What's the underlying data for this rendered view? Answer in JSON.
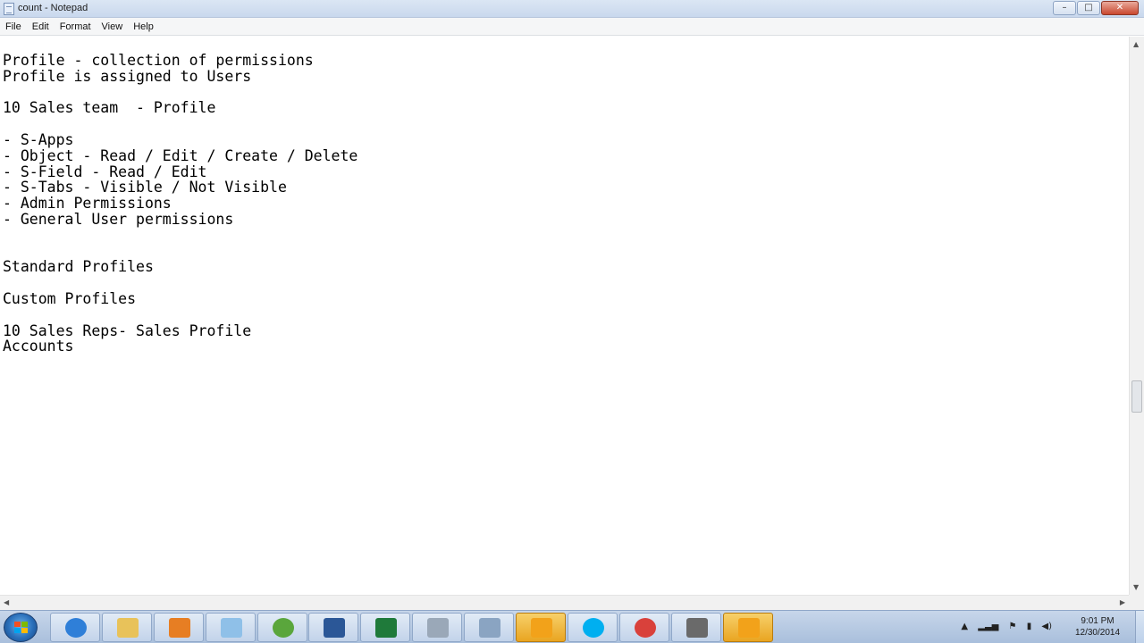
{
  "window": {
    "title": "count - Notepad",
    "minimize": "–",
    "maximize": "□",
    "close": "✕"
  },
  "menu": [
    "File",
    "Edit",
    "Format",
    "View",
    "Help"
  ],
  "editor": {
    "lines": [
      "Profile - collection of permissions",
      "Profile is assigned to Users",
      "",
      "10 Sales team  - Profile",
      "",
      "- S-Apps",
      "- Object - Read / Edit / Create / Delete",
      "- S-Field - Read / Edit",
      "- S-Tabs - Visible / Not Visible",
      "- Admin Permissions",
      "- General User permissions",
      "",
      "",
      "Standard Profiles",
      "",
      "Custom Profiles",
      "",
      "10 Sales Reps- Sales Profile",
      "Accounts"
    ]
  },
  "taskbar": {
    "apps": [
      {
        "name": "internet-explorer",
        "color": "#2f7fd8"
      },
      {
        "name": "windows-explorer",
        "color": "#e8c25a"
      },
      {
        "name": "media-player",
        "color": "#e77e23"
      },
      {
        "name": "notepad",
        "color": "#8fc0e8"
      },
      {
        "name": "utorrent",
        "color": "#5aa63c"
      },
      {
        "name": "word",
        "color": "#2b5797"
      },
      {
        "name": "excel",
        "color": "#1f7a3a"
      },
      {
        "name": "calculator",
        "color": "#9aa8b8"
      },
      {
        "name": "virtual-box",
        "color": "#8aa4c2"
      },
      {
        "name": "flower-app",
        "color": "#f2a21a"
      },
      {
        "name": "skype",
        "color": "#00aff0"
      },
      {
        "name": "chrome",
        "color": "#d9413b"
      },
      {
        "name": "recorder",
        "color": "#6a6a6a"
      },
      {
        "name": "flower-app-2",
        "color": "#f2a21a"
      }
    ],
    "tray_icons": [
      "▲",
      "signal",
      "flag",
      "power",
      "speaker"
    ],
    "clock_time": "9:01 PM",
    "clock_date": "12/30/2014"
  }
}
